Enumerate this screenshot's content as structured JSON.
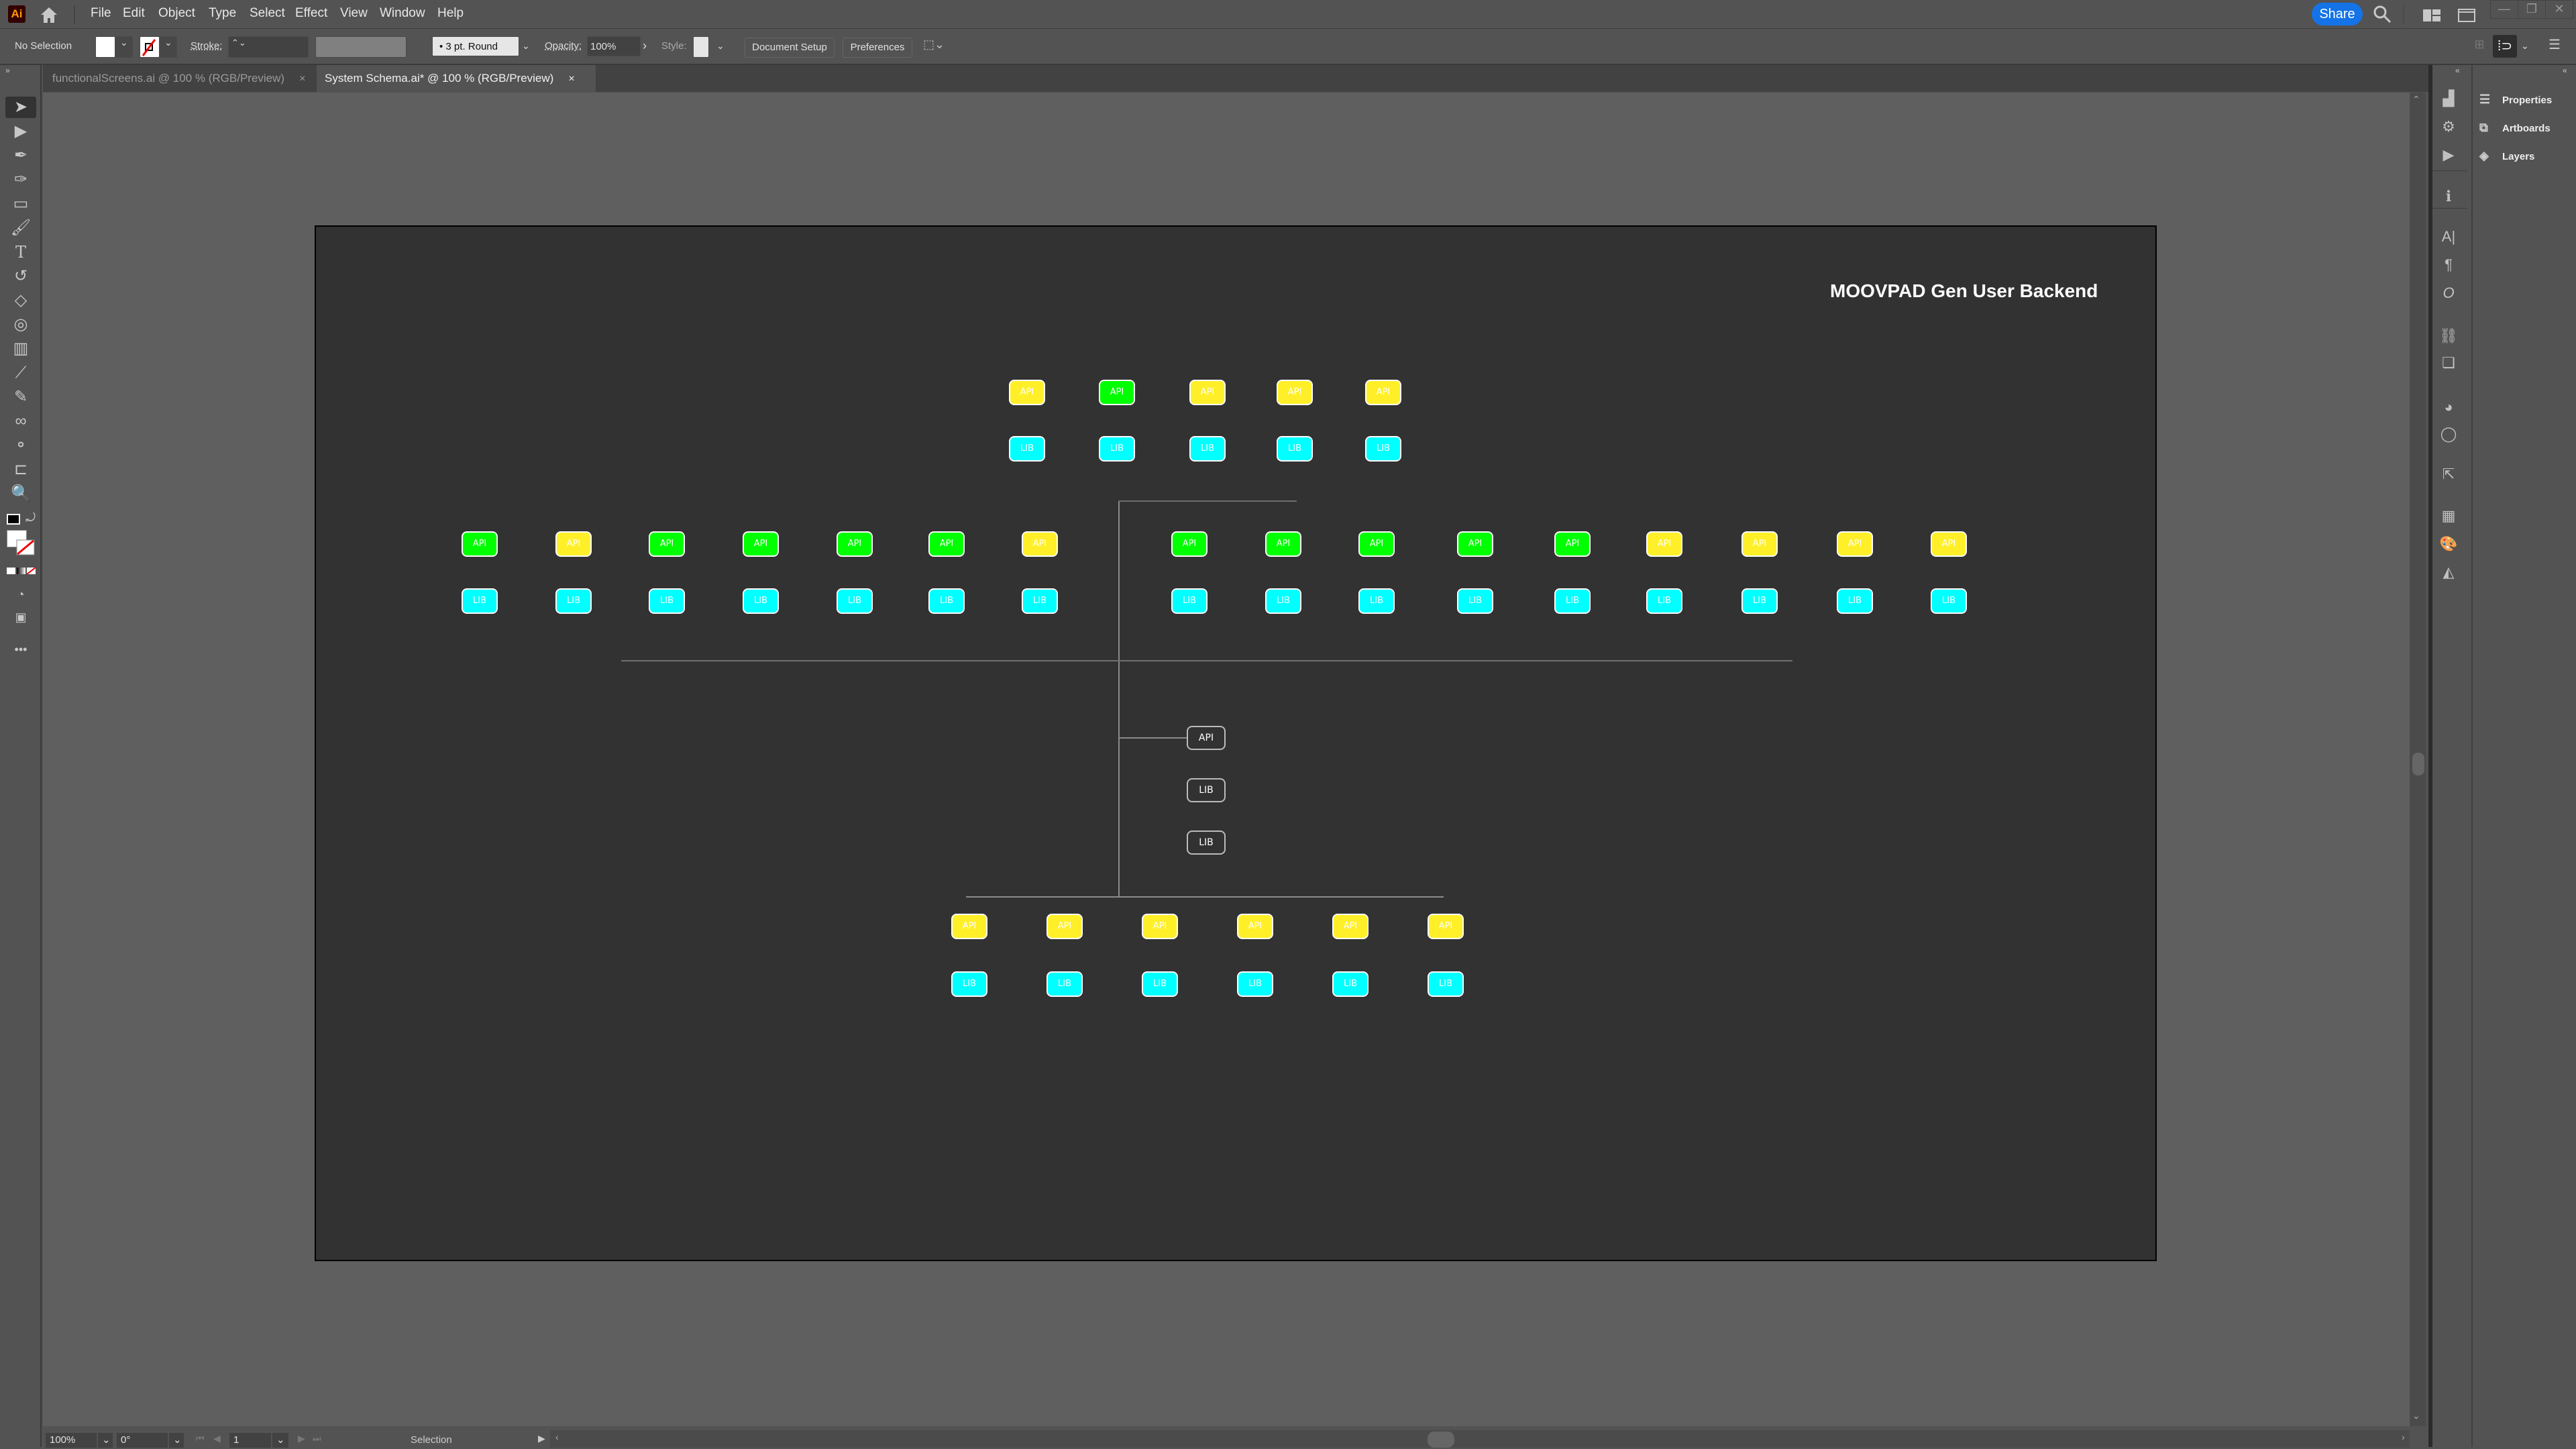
{
  "app": {
    "logo": "Ai",
    "name": "Adobe Illustrator"
  },
  "menu": [
    "File",
    "Edit",
    "Object",
    "Type",
    "Select",
    "Effect",
    "View",
    "Window",
    "Help"
  ],
  "topright": {
    "share": "Share"
  },
  "control_bar": {
    "selection": "No Selection",
    "stroke_label": "Stroke:",
    "stroke_value": "",
    "brush": "3 pt. Round",
    "opacity_label": "Opacity:",
    "opacity_value": "100%",
    "style_label": "Style:",
    "document_setup": "Document Setup",
    "preferences": "Preferences"
  },
  "tabs": [
    {
      "label": "functionalScreens.ai @ 100 % (RGB/Preview)",
      "active": false,
      "close": "×"
    },
    {
      "label": "System Schema.ai* @ 100 % (RGB/Preview)",
      "active": true,
      "close": "×"
    }
  ],
  "tools": [
    "selection-tool",
    "direct-selection-tool",
    "pen-tool",
    "curvature-tool",
    "rectangle-tool",
    "paintbrush-tool",
    "type-tool",
    "rotate-tool",
    "eraser-tool",
    "shape-builder-tool",
    "gradient-tool",
    "eyedropper-measure-tool",
    "eyedropper-tool",
    "blend-tool",
    "symbol-sprayer-tool",
    "artboard-tool",
    "zoom-tool"
  ],
  "colors": {
    "api_green": "#00ff00",
    "api_yellow": "#ffef29",
    "lib_cyan": "#00ffff",
    "artboard": "#323232",
    "pasteboard": "#5f5f5f",
    "accent": "#1473e6"
  },
  "diagram": {
    "title": "MOOVPAD Gen User Backend",
    "top_group": {
      "api": [
        "yellow",
        "green",
        "yellow",
        "yellow",
        "yellow"
      ],
      "lib_count": 5
    },
    "middle_left_group": {
      "api": [
        "green",
        "yellow",
        "green",
        "green",
        "green",
        "green",
        "yellow"
      ],
      "lib_count": 7
    },
    "middle_right_group": {
      "api": [
        "green",
        "green",
        "green",
        "green",
        "green",
        "yellow",
        "yellow",
        "yellow",
        "yellow"
      ],
      "lib_count": 9
    },
    "center_outlined": [
      "API",
      "LIB",
      "LIB"
    ],
    "bottom_group": {
      "api": [
        "yellow",
        "yellow",
        "yellow",
        "yellow",
        "yellow",
        "yellow"
      ],
      "lib_count": 6
    },
    "api_label": "API",
    "lib_label": "LIB"
  },
  "status_bar": {
    "zoom": "100%",
    "rotation": "0°",
    "artboard_number": "1",
    "tool": "Selection"
  },
  "panels": [
    {
      "label": "Properties",
      "icon": "sliders-icon"
    },
    {
      "label": "Artboards",
      "icon": "artboards-icon"
    },
    {
      "label": "Layers",
      "icon": "layers-icon"
    }
  ]
}
